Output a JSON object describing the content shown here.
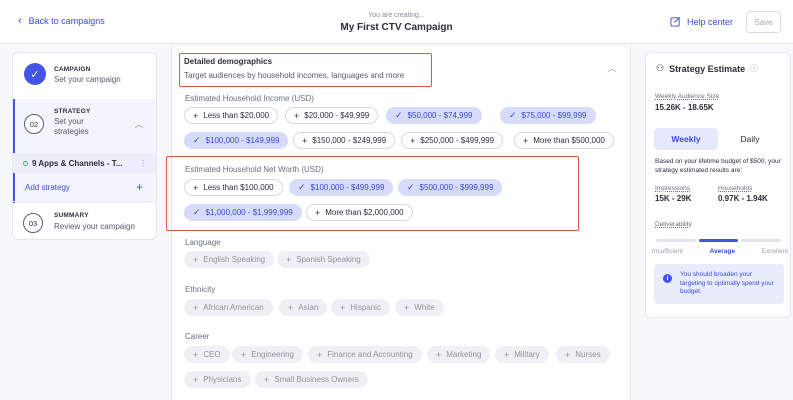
{
  "header": {
    "back_label": "Back to campaigns",
    "creating_label": "You are creating...",
    "campaign_name": "My First CTV Campaign",
    "help_label": "Help center",
    "save_label": "Save"
  },
  "sidebar": {
    "step1": {
      "title": "CAMPAIGN",
      "subtitle": "Set your campaign"
    },
    "step2": {
      "number": "02",
      "title": "STRATEGY",
      "subtitle": "Set your strategies",
      "app_item": "9 Apps & Channels - T...",
      "add_label": "Add strategy"
    },
    "step3": {
      "number": "03",
      "title": "SUMMARY",
      "subtitle": "Review your campaign"
    }
  },
  "main": {
    "section_title": "Detailed demographics",
    "section_subtitle": "Target audiences by household incomes, languages and more",
    "income": {
      "label": "Estimated Household Income (USD)",
      "options": [
        {
          "text": "Less than $20,000",
          "selected": false
        },
        {
          "text": "$20,000 - $49,999",
          "selected": false
        },
        {
          "text": "$50,000 - $74,999",
          "selected": true
        },
        {
          "text": "$75,000 - $99,999",
          "selected": true
        },
        {
          "text": "$100,000 - $149,999",
          "selected": true
        },
        {
          "text": "$150,000 - $249,999",
          "selected": false
        },
        {
          "text": "$250,000 - $499,999",
          "selected": false
        },
        {
          "text": "More than $500,000",
          "selected": false
        }
      ]
    },
    "networth": {
      "label": "Estimated Household Net Worth (USD)",
      "options": [
        {
          "text": "Less than $100,000",
          "selected": false
        },
        {
          "text": "$100,000 - $499,999",
          "selected": true
        },
        {
          "text": "$500,000 - $999,999",
          "selected": true
        },
        {
          "text": "$1,000,000 - $1,999,999",
          "selected": true
        },
        {
          "text": "More than $2,000,000",
          "selected": false
        }
      ]
    },
    "language": {
      "label": "Language",
      "options": [
        "English Speaking",
        "Spanish Speaking"
      ]
    },
    "ethnicity": {
      "label": "Ethnicity",
      "options": [
        "African American",
        "Asian",
        "Hispanic",
        "White"
      ]
    },
    "career": {
      "label": "Career",
      "options": [
        "CEO",
        "Engineering",
        "Finance and Accounting",
        "Marketing",
        "Military",
        "Nurses",
        "Physicians",
        "Small Business Owners"
      ]
    }
  },
  "estimate": {
    "title": "Strategy Estimate",
    "weekly_audience_label": "Weekly Audience Size",
    "weekly_audience_value": "15.26K - 18.65K",
    "toggle_weekly": "Weekly",
    "toggle_daily": "Daily",
    "note": "Based on your lifetime budget of $500, your strategy estimated results are:",
    "impressions_label": "Impressions",
    "impressions_value": "15K - 29K",
    "households_label": "Households",
    "households_value": "0.97K - 1.94K",
    "deliverability_label": "Deliverability",
    "deliv_insufficient": "Insufficient",
    "deliv_average": "Average",
    "deliv_excellent": "Excellent",
    "info_text": "You should broaden your targeting to optimally spend your budget."
  },
  "colors": {
    "accent": "#4455e6",
    "highlight": "#e0554a",
    "selected_chip": "#d7dbfa"
  }
}
